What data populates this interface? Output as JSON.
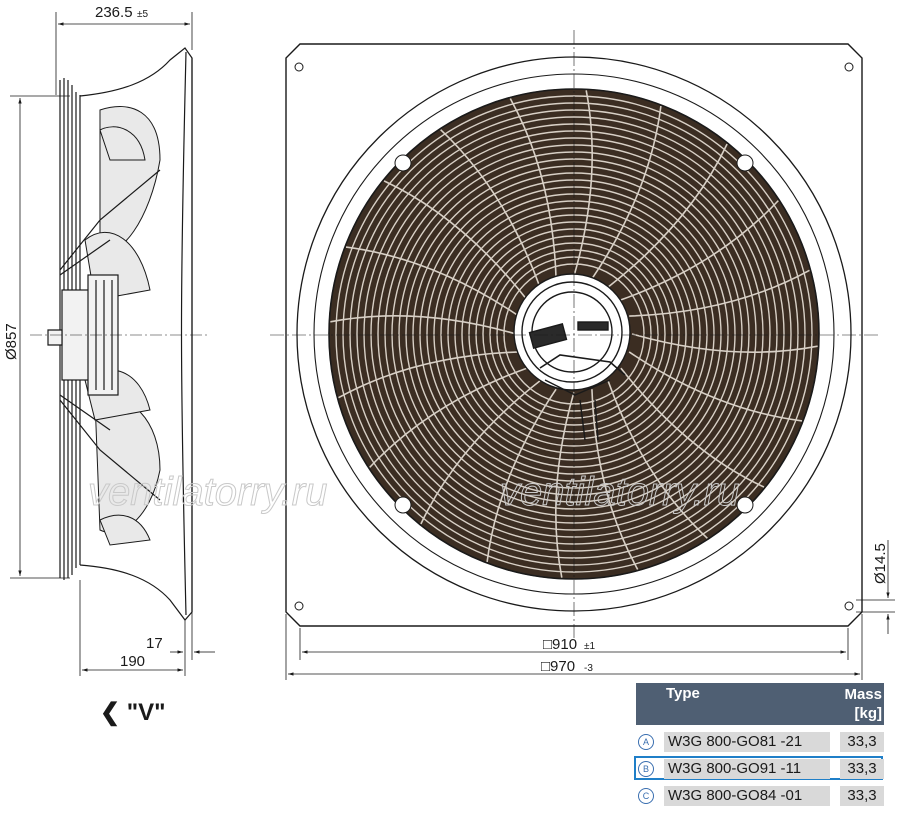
{
  "dimensions": {
    "depth_total": "236.5",
    "depth_total_tol": "±5",
    "diameter": "Ø857",
    "depth_a": "17",
    "depth_b": "190",
    "inner_square": "□910",
    "inner_square_tol": "±1",
    "outer_square": "□970",
    "outer_square_tol": "-3",
    "hole": "Ø14.5"
  },
  "view_label": "❮ \"V\"",
  "watermark": "ventilatorry.ru",
  "watermark2": "ventilatorry.ru",
  "table": {
    "headers": {
      "type": "Type",
      "mass_line1": "Mass",
      "mass_line2": "[kg]"
    },
    "rows": [
      {
        "mark": "A",
        "type": "W3G 800-GO81 -21",
        "mass": "33,3",
        "highlighted": false
      },
      {
        "mark": "B",
        "type": "W3G 800-GO91 -11",
        "mass": "33,3",
        "highlighted": true
      },
      {
        "mark": "C",
        "type": "W3G 800-GO84 -01",
        "mass": "33,3",
        "highlighted": false
      }
    ],
    "header_color": "#4f5f73",
    "highlight_color": "#1f7fc8"
  }
}
